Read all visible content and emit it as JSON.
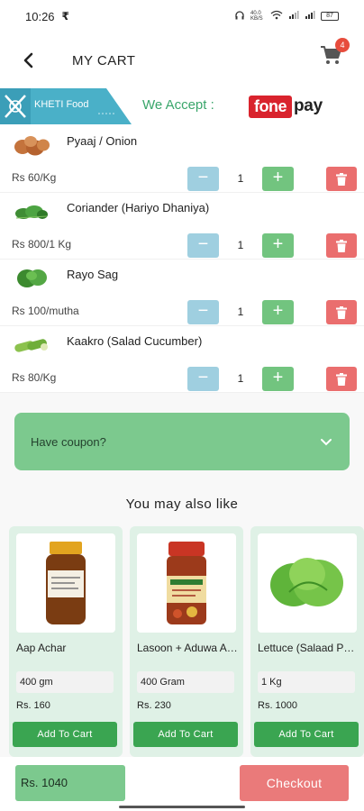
{
  "status_bar": {
    "time": "10:26",
    "currency_icon": "₹",
    "data_speed": "40.0 KB/S",
    "battery": "87"
  },
  "header": {
    "title": "MY CART",
    "cart_count": "4",
    "back_icon": "arrow-left-icon",
    "cart_icon": "shopping-cart-icon"
  },
  "banner": {
    "brand": "KHETI Food",
    "accept_label": "We Accept :",
    "fonepay_fone": "fone",
    "fonepay_pay": "pay"
  },
  "cart_items": [
    {
      "name": "Pyaaj / Onion",
      "price": "Rs 60/Kg",
      "qty": "1"
    },
    {
      "name": "Coriander (Hariyo Dhaniya)",
      "price": "Rs 800/1 Kg",
      "qty": "1"
    },
    {
      "name": "Rayo Sag",
      "price": "Rs 100/mutha",
      "qty": "1"
    },
    {
      "name": "Kaakro (Salad Cucumber)",
      "price": "Rs 80/Kg",
      "qty": "1"
    }
  ],
  "controls": {
    "minus": "−",
    "plus": "+"
  },
  "coupon": {
    "label": "Have coupon?"
  },
  "recommendations": {
    "title": "You may also like",
    "products": [
      {
        "name": "Aap Achar",
        "variant": "400 gm",
        "price": "Rs. 160",
        "button": "Add To Cart"
      },
      {
        "name": "Lasoon + Aduwa Achar",
        "variant": "400 Gram",
        "price": "Rs. 230",
        "button": "Add To Cart"
      },
      {
        "name": "Lettuce (Salaad Patta)",
        "variant": "1 Kg",
        "price": "Rs. 1000",
        "button": "Add To Cart"
      }
    ]
  },
  "footer": {
    "total": "Rs. 1040",
    "checkout": "Checkout"
  },
  "colors": {
    "green_accent": "#3aa551",
    "light_green": "#7cc98e",
    "blue_minus": "#9fcfe0",
    "delete_red": "#ea6e6e",
    "badge_red": "#e74c3c"
  }
}
